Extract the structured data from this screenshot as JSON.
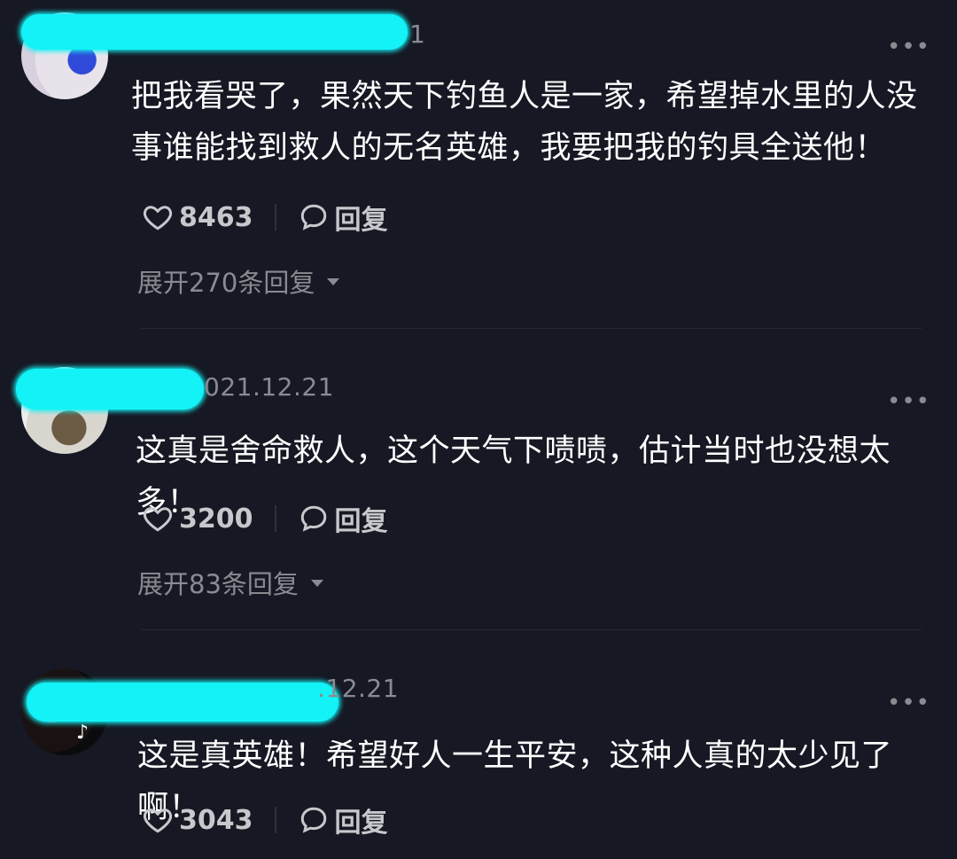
{
  "comments": [
    {
      "date": "1",
      "text": "把我看哭了，果然天下钓鱼人是一家，希望掉水里的人没事谁能找到救人的无名英雄，我要把我的钓具全送他！",
      "likes": "8463",
      "reply_label": "回复",
      "expand_label": "展开270条回复",
      "more_label": "•••"
    },
    {
      "date": "021.12.21",
      "text": "这真是舍命救人，这个天气下啧啧，估计当时也没想太多！",
      "likes": "3200",
      "reply_label": "回复",
      "expand_label": "展开83条回复",
      "more_label": "•••"
    },
    {
      "date": ".12.21",
      "text": "这是真英雄！希望好人一生平安，这种人真的太少见了啊！",
      "likes": "3043",
      "reply_label": "回复",
      "more_label": "•••"
    }
  ],
  "colors": {
    "background": "#161823",
    "redaction": "#13f2f6",
    "secondary_text": "#8a8b91",
    "action_text": "#c7c8cc"
  },
  "icons": [
    "heart-icon",
    "comment-bubble-icon",
    "more-dots-icon",
    "caret-down-icon",
    "tiktok-icon"
  ]
}
